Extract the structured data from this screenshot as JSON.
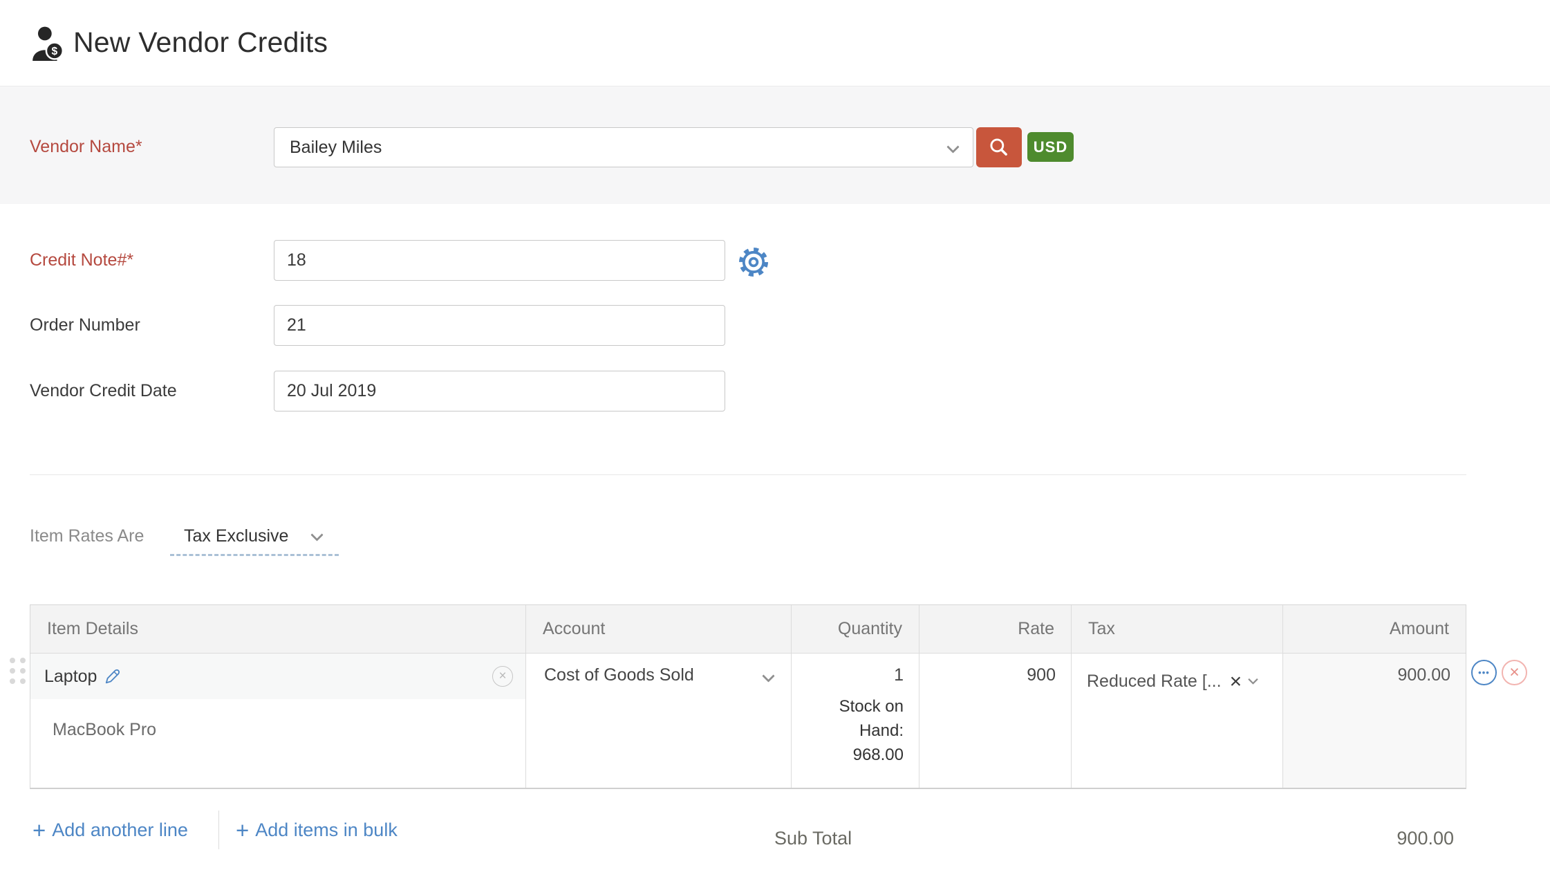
{
  "colors": {
    "accent_red": "#c8563c",
    "badge_green": "#4e8b2e",
    "link_blue": "#4d86c5",
    "label_red": "#b5493f"
  },
  "header": {
    "title": "New Vendor Credits"
  },
  "vendor": {
    "label": "Vendor Name*",
    "value": "Bailey Miles",
    "currency": "USD"
  },
  "fields": {
    "credit_note": {
      "label": "Credit Note#*",
      "value": "18"
    },
    "order_number": {
      "label": "Order Number",
      "value": "21"
    },
    "vendor_credit_date": {
      "label": "Vendor Credit Date",
      "value": "20 Jul 2019"
    }
  },
  "item_rates": {
    "label": "Item Rates Are",
    "value": "Tax Exclusive"
  },
  "table": {
    "headers": {
      "item_details": "Item Details",
      "account": "Account",
      "quantity": "Quantity",
      "rate": "Rate",
      "tax": "Tax",
      "amount": "Amount"
    },
    "row": {
      "item_name": "Laptop",
      "item_description": "MacBook Pro",
      "account": "Cost of Goods Sold",
      "quantity": "1",
      "stock_label": "Stock on Hand:",
      "stock_value": "968.00",
      "rate": "900",
      "tax": "Reduced Rate [...",
      "amount": "900.00"
    }
  },
  "actions": {
    "add_line": "Add another line",
    "add_bulk": "Add items in bulk"
  },
  "totals": {
    "sub_total_label": "Sub Total",
    "sub_total_value": "900.00"
  },
  "icons": {
    "plus": "+",
    "close": "×",
    "ellipsis": "•••",
    "dollar": "$"
  }
}
